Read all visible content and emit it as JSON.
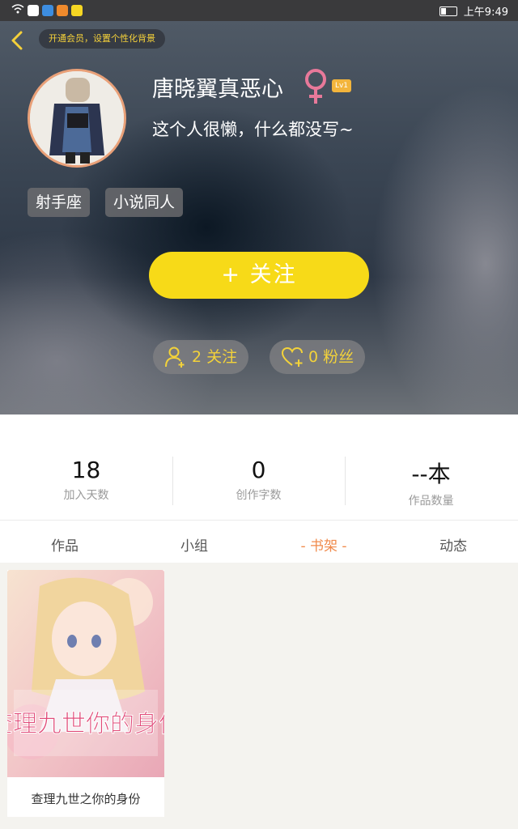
{
  "status_bar": {
    "time": "上午9:49"
  },
  "header": {
    "vip_tip": "开通会员，设置个性化背景",
    "nickname": "唐晓翼真恶心",
    "level": "Lv1",
    "signature": "这个人很懒，什么都没写~",
    "tags": [
      "射手座",
      "小说同人"
    ],
    "follow_button": "+  关注",
    "following": "2 关注",
    "fans": "0 粉丝"
  },
  "stats": [
    {
      "value": "18",
      "label": "加入天数"
    },
    {
      "value": "0",
      "label": "创作字数"
    },
    {
      "value": "--本",
      "label": "作品数量"
    }
  ],
  "tabs": [
    "作品",
    "小组",
    "- 书架 -",
    "动态"
  ],
  "active_tab_index": 2,
  "bookshelf": [
    {
      "title": "查理九世之你的身份",
      "cover_text": "查理九世你的身份"
    }
  ],
  "colors": {
    "accent_yellow": "#f7da18",
    "tab_active": "#f08a4b",
    "gender_pink": "#e8799a"
  }
}
